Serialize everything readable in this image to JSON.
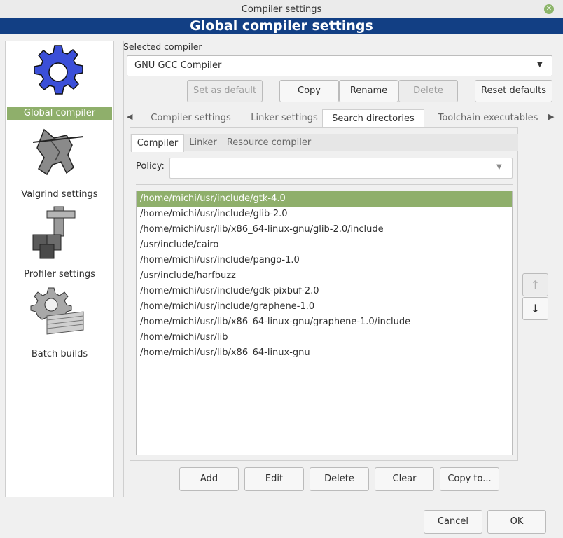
{
  "window": {
    "title": "Compiler settings",
    "close_glyph": "✕"
  },
  "header": {
    "title": "Global compiler settings"
  },
  "sidebar": {
    "items": [
      {
        "label": "Global compiler settings",
        "icon": "gear-icon",
        "selected": true
      },
      {
        "label": "Valgrind settings",
        "icon": "valgrind-knight-icon",
        "selected": false
      },
      {
        "label": "Profiler settings",
        "icon": "profiler-caliper-icon",
        "selected": false
      },
      {
        "label": "Batch builds",
        "icon": "batch-builds-icon",
        "selected": false
      }
    ]
  },
  "compiler": {
    "group_label": "Selected compiler",
    "selected": "GNU GCC Compiler",
    "buttons": {
      "set_default": "Set as default",
      "copy": "Copy",
      "rename": "Rename",
      "delete": "Delete",
      "reset": "Reset defaults"
    }
  },
  "tabs": {
    "items": [
      "Compiler settings",
      "Linker settings",
      "Search directories",
      "Toolchain executables"
    ],
    "active": "Search directories"
  },
  "subtabs": {
    "items": [
      "Compiler",
      "Linker",
      "Resource compiler"
    ],
    "active": "Compiler"
  },
  "policy": {
    "label": "Policy:",
    "value": ""
  },
  "directories": [
    "/home/michi/usr/include/gtk-4.0",
    "/home/michi/usr/include/glib-2.0",
    "/home/michi/usr/lib/x86_64-linux-gnu/glib-2.0/include",
    "/usr/include/cairo",
    "/home/michi/usr/include/pango-1.0",
    "/usr/include/harfbuzz",
    "/home/michi/usr/include/gdk-pixbuf-2.0",
    "/home/michi/usr/include/graphene-1.0",
    "/home/michi/usr/lib/x86_64-linux-gnu/graphene-1.0/include",
    "/home/michi/usr/lib",
    "/home/michi/usr/lib/x86_64-linux-gnu"
  ],
  "selected_directory_index": 0,
  "move_buttons": {
    "up": "↑",
    "down": "↓"
  },
  "list_buttons": {
    "add": "Add",
    "edit": "Edit",
    "delete": "Delete",
    "clear": "Clear",
    "copy_to": "Copy to..."
  },
  "dialog_buttons": {
    "cancel": "Cancel",
    "ok": "OK"
  },
  "colors": {
    "header_band": "#123f84",
    "selection": "#8faf6b"
  }
}
